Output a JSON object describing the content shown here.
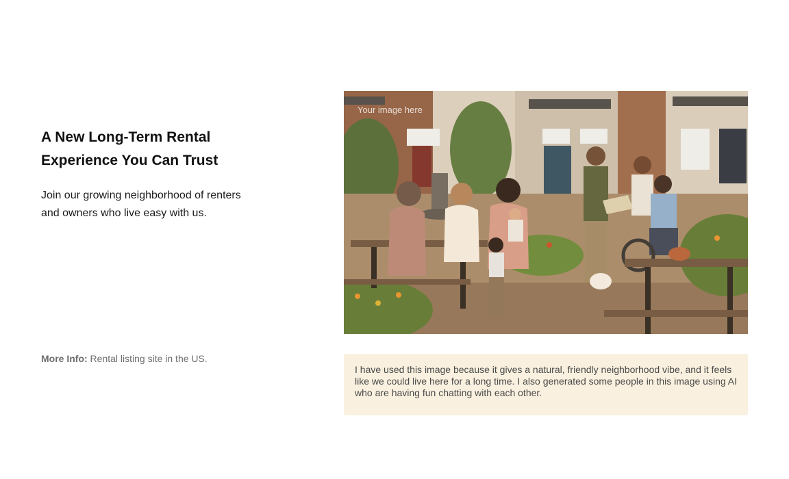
{
  "hero": {
    "headline": "A New Long-Term Rental Experience You Can Trust",
    "subtext": "Join our growing neighborhood of renters and owners who live easy with us."
  },
  "more_info": {
    "label": "More Info:",
    "value": "Rental listing site in the US."
  },
  "image": {
    "placeholder": "Your image here"
  },
  "note": {
    "text": "I have used this image because it gives a natural, friendly neighborhood vibe, and it feels like we could live here for a long time. I also generated some people in this image using AI who are having fun chatting with each other."
  }
}
